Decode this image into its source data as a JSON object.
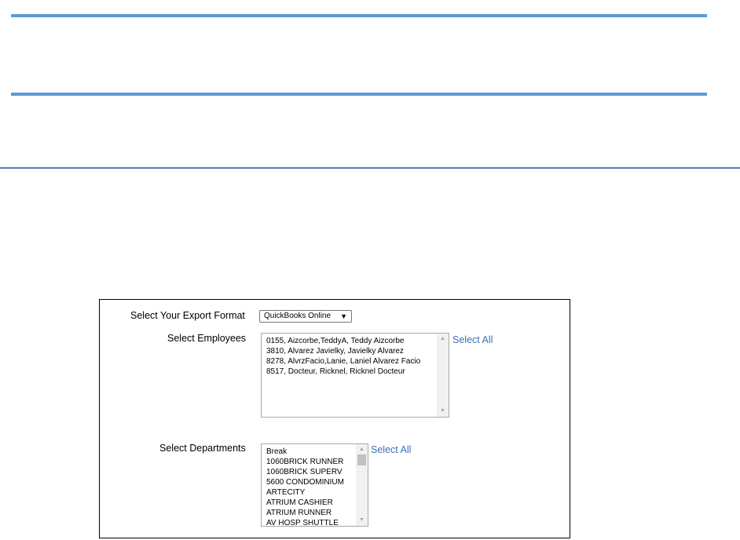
{
  "form": {
    "export_format_label": "Select Your Export Format",
    "export_format_selected": "QuickBooks Online",
    "employees_label": "Select Employees",
    "employees": [
      "0155,  Aizcorbe,TeddyA,  Teddy Aizcorbe",
      "3810,  Alvarez Javielky,  Javielky Alvarez",
      "8278,  AlvrzFacio,Lanie,  Laniel Alvarez Facio",
      "8517,  Docteur, Ricknel,  Ricknel Docteur"
    ],
    "employees_select_all": "Select All",
    "departments_label": "Select Departments",
    "departments": [
      "Break",
      "1060BRICK RUNNER",
      "1060BRICK SUPERV",
      "5600 CONDOMINIUM",
      "ARTECITY",
      "ATRIUM CASHIER",
      "ATRIUM RUNNER",
      "AV HOSP SHUTTLE"
    ],
    "departments_select_all": "Select All"
  },
  "icons": {
    "dropdown": "chevron-down-icon",
    "scroll_up": "scroll-up-arrow-icon",
    "scroll_down": "scroll-down-arrow-icon"
  },
  "colors": {
    "accent_rule": "#5b9bd5",
    "link": "#3d6fb5"
  }
}
